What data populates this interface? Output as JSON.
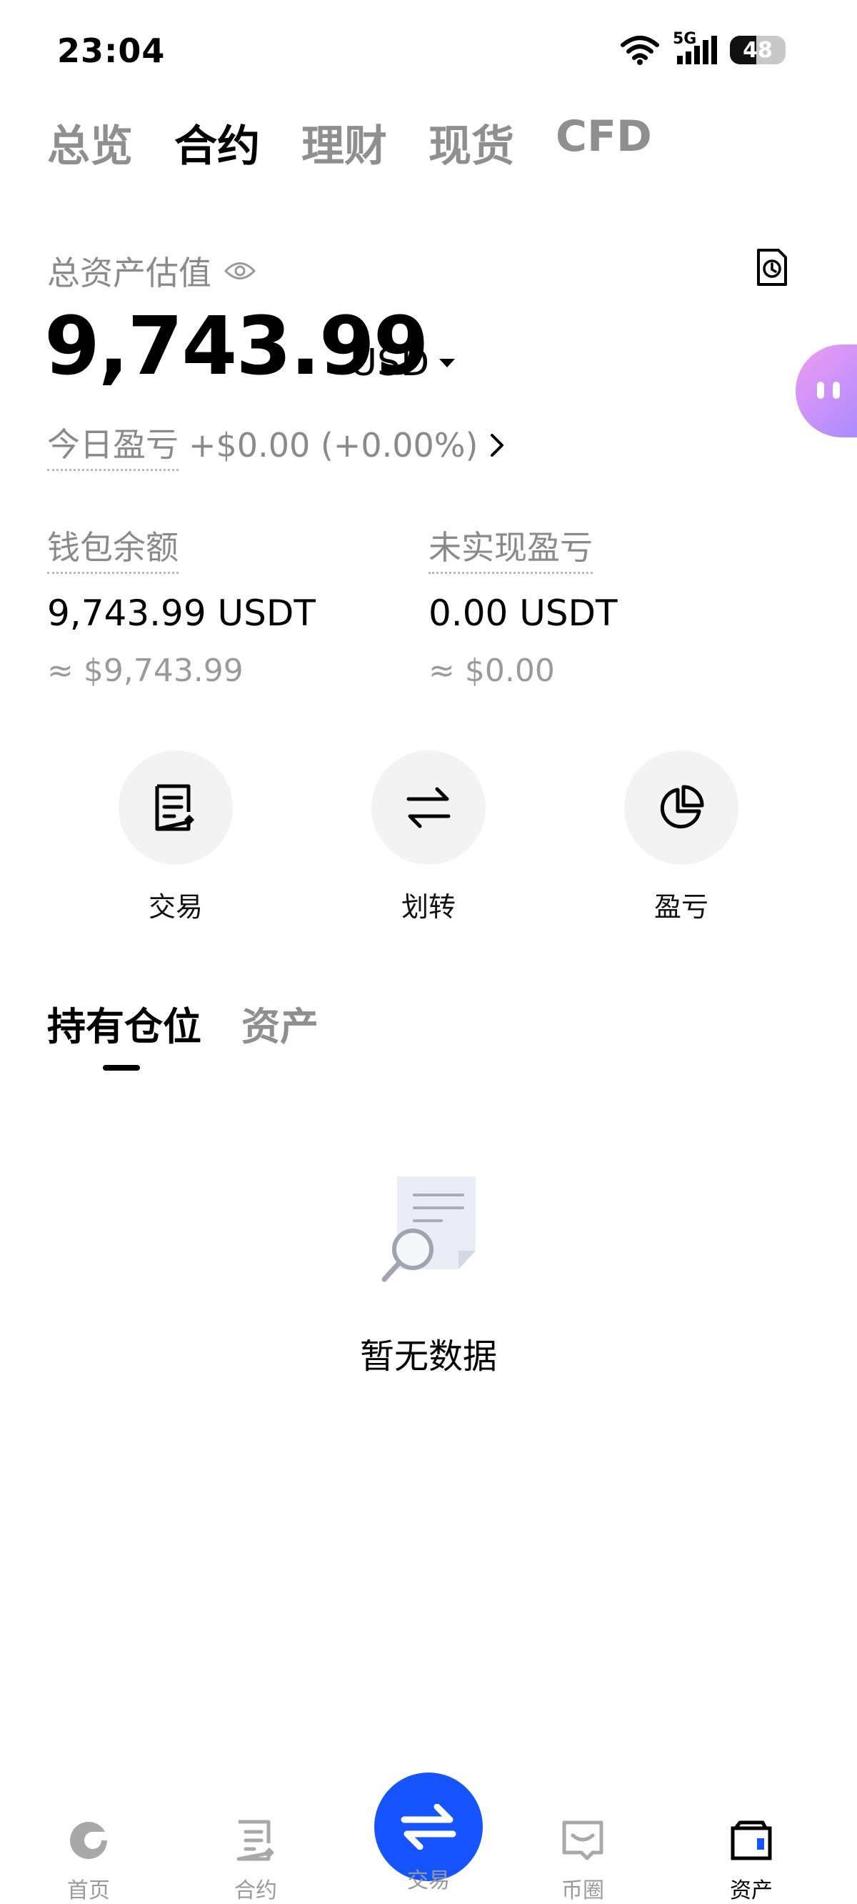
{
  "status_bar": {
    "time": "23:04",
    "network": "5G",
    "battery": "48",
    "battery_level": 0.48
  },
  "top_tabs": [
    {
      "label": "总览",
      "active": false
    },
    {
      "label": "合约",
      "active": true
    },
    {
      "label": "理财",
      "active": false
    },
    {
      "label": "现货",
      "active": false
    },
    {
      "label": "CFD",
      "active": false
    }
  ],
  "summary": {
    "total_label": "总资产估值",
    "total_amount": "9,743.99",
    "currency": "USD",
    "today_pnl_label": "今日盈亏",
    "today_pnl_value": "+$0.00 (+0.00%)"
  },
  "balances": {
    "wallet": {
      "label": "钱包余额",
      "value": "9,743.99 USDT",
      "approx": "≈ $9,743.99"
    },
    "unrealized": {
      "label": "未实现盈亏",
      "value": "0.00 USDT",
      "approx": "≈ $0.00"
    }
  },
  "actions": [
    {
      "label": "交易",
      "icon": "orders-icon"
    },
    {
      "label": "划转",
      "icon": "transfer-icon"
    },
    {
      "label": "盈亏",
      "icon": "pie-chart-icon"
    }
  ],
  "section_tabs": [
    {
      "label": "持有仓位",
      "active": true
    },
    {
      "label": "资产",
      "active": false
    }
  ],
  "empty_state": {
    "text": "暂无数据"
  },
  "bottom_nav": [
    {
      "label": "首页",
      "icon": "home-icon",
      "active": false
    },
    {
      "label": "合约",
      "icon": "contract-icon",
      "active": false
    },
    {
      "label": "交易",
      "icon": "trade-swap-icon",
      "active": false
    },
    {
      "label": "币圈",
      "icon": "community-icon",
      "active": false
    },
    {
      "label": "资产",
      "icon": "wallet-icon",
      "active": true
    }
  ],
  "colors": {
    "accent": "#1554ff",
    "text_secondary": "#8a8a8a",
    "action_bg": "#f3f3f3"
  }
}
